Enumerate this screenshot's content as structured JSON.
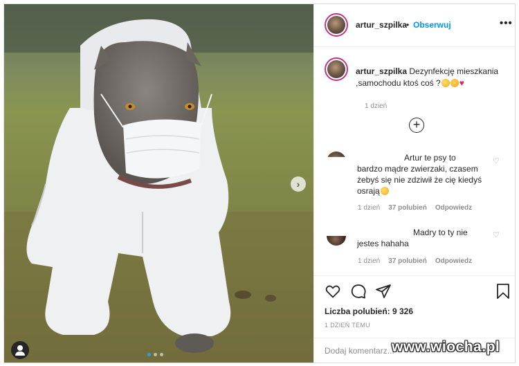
{
  "post": {
    "username": "artur_szpilka",
    "separator": "•",
    "follow_label": "Obserwuj",
    "more_label": "•••"
  },
  "caption": {
    "username": "artur_szpilka",
    "text": "Dezynfekcję mieszkania ,samochodu ktoś coś ?",
    "time": "1 dzień"
  },
  "comments": [
    {
      "text_line1": "Artur te psy to",
      "text_rest": "bardzo mądre zwierzaki, czasem żebyś się nie zdziwił że cię kiedyś osrają",
      "time": "1 dzień",
      "likes": "37 polubień",
      "reply": "Odpowiedz"
    },
    {
      "text_line1": "Madry to ty nie",
      "text_rest": "jestes hahaha",
      "time": "1 dzień",
      "likes": "37 polubień",
      "reply": "Odpowiedz"
    }
  ],
  "stats": {
    "likes": "Liczba polubień: 9 326",
    "posted": "1 DZIEŃ TEMU"
  },
  "add_comment": {
    "placeholder": "Dodaj komentarz..."
  },
  "icons": {
    "more": "more-dots-icon",
    "load_more": "plus-circle-icon",
    "like": "heart-outline-icon",
    "comment": "speech-bubble-icon",
    "share": "paper-plane-icon",
    "save": "bookmark-icon",
    "next": "chevron-right-icon",
    "tag": "user-tag-icon"
  },
  "colors": {
    "follow": "#0095f6",
    "meta": "#8e8e8e",
    "carousel_active_dot": "#3897f0"
  },
  "watermark": "www.wiocha.pl"
}
